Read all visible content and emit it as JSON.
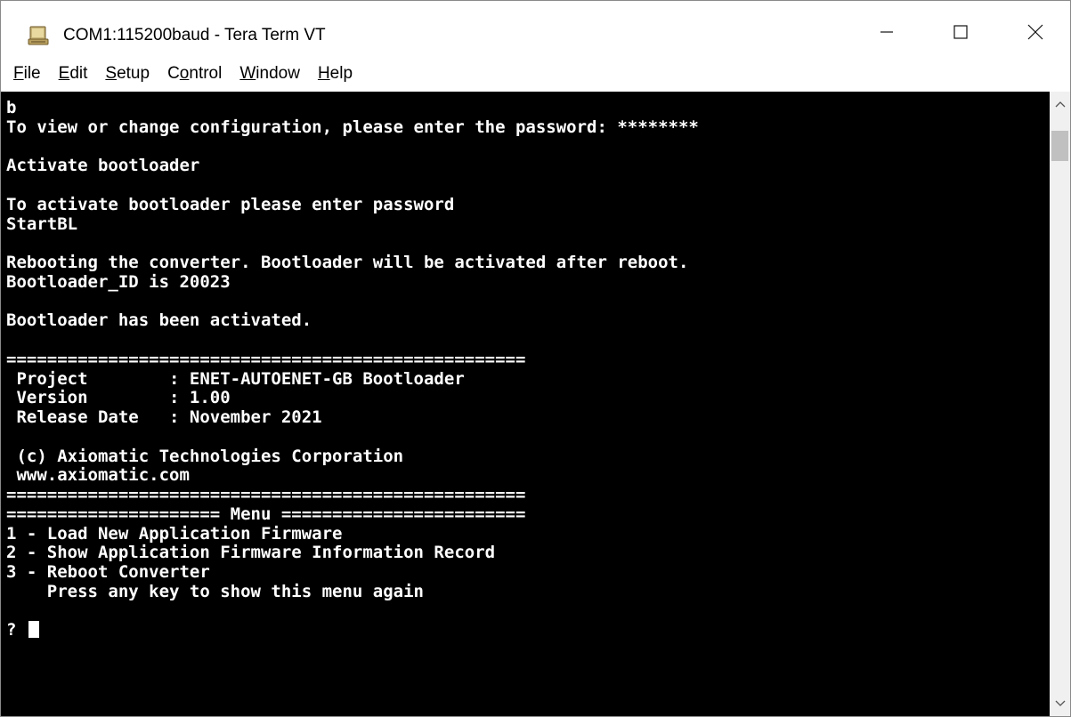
{
  "window": {
    "title": "COM1:115200baud - Tera Term VT",
    "icon": "tera-term-icon"
  },
  "titlebar_buttons": {
    "minimize_icon": "minimize-icon",
    "maximize_icon": "maximize-icon",
    "close_icon": "close-icon"
  },
  "menubar": {
    "items": [
      {
        "accel": "F",
        "rest": "ile"
      },
      {
        "accel": "E",
        "rest": "dit"
      },
      {
        "accel": "S",
        "rest": "etup"
      },
      {
        "pre": "C",
        "accel": "o",
        "rest": "ntrol"
      },
      {
        "accel": "W",
        "rest": "indow"
      },
      {
        "accel": "H",
        "rest": "elp"
      }
    ]
  },
  "terminal": {
    "lines": [
      "b",
      "To view or change configuration, please enter the password: ********",
      "",
      "Activate bootloader",
      "",
      "To activate bootloader please enter password",
      "StartBL",
      "",
      "Rebooting the converter. Bootloader will be activated after reboot.",
      "Bootloader_ID is 20023",
      "",
      "Bootloader has been activated.",
      "",
      "===================================================",
      " Project        : ENET-AUTOENET-GB Bootloader",
      " Version        : 1.00",
      " Release Date   : November 2021",
      "",
      " (c) Axiomatic Technologies Corporation",
      " www.axiomatic.com",
      "===================================================",
      "===================== Menu ========================",
      "1 - Load New Application Firmware",
      "2 - Show Application Firmware Information Record",
      "3 - Reboot Converter",
      "    Press any key to show this menu again",
      ""
    ],
    "prompt": "? "
  },
  "colors": {
    "terminal_bg": "#000000",
    "terminal_fg": "#ffffff",
    "chrome_bg": "#ffffff",
    "scrollbar_bg": "#f0f0f0"
  }
}
